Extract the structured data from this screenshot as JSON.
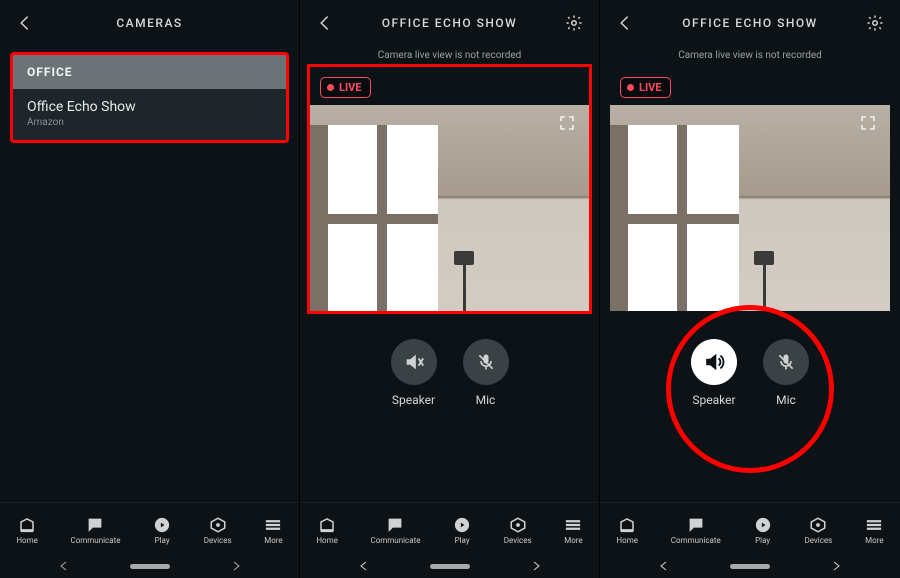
{
  "panes": {
    "list": {
      "title": "CAMERAS",
      "group": "OFFICE",
      "item_title": "Office Echo Show",
      "item_sub": "Amazon"
    },
    "view": {
      "title": "OFFICE ECHO SHOW",
      "notice": "Camera live view is not recorded",
      "live": "LIVE",
      "speaker": "Speaker",
      "mic": "Mic"
    }
  },
  "nav": {
    "home": "Home",
    "communicate": "Communicate",
    "play": "Play",
    "devices": "Devices",
    "more": "More"
  }
}
